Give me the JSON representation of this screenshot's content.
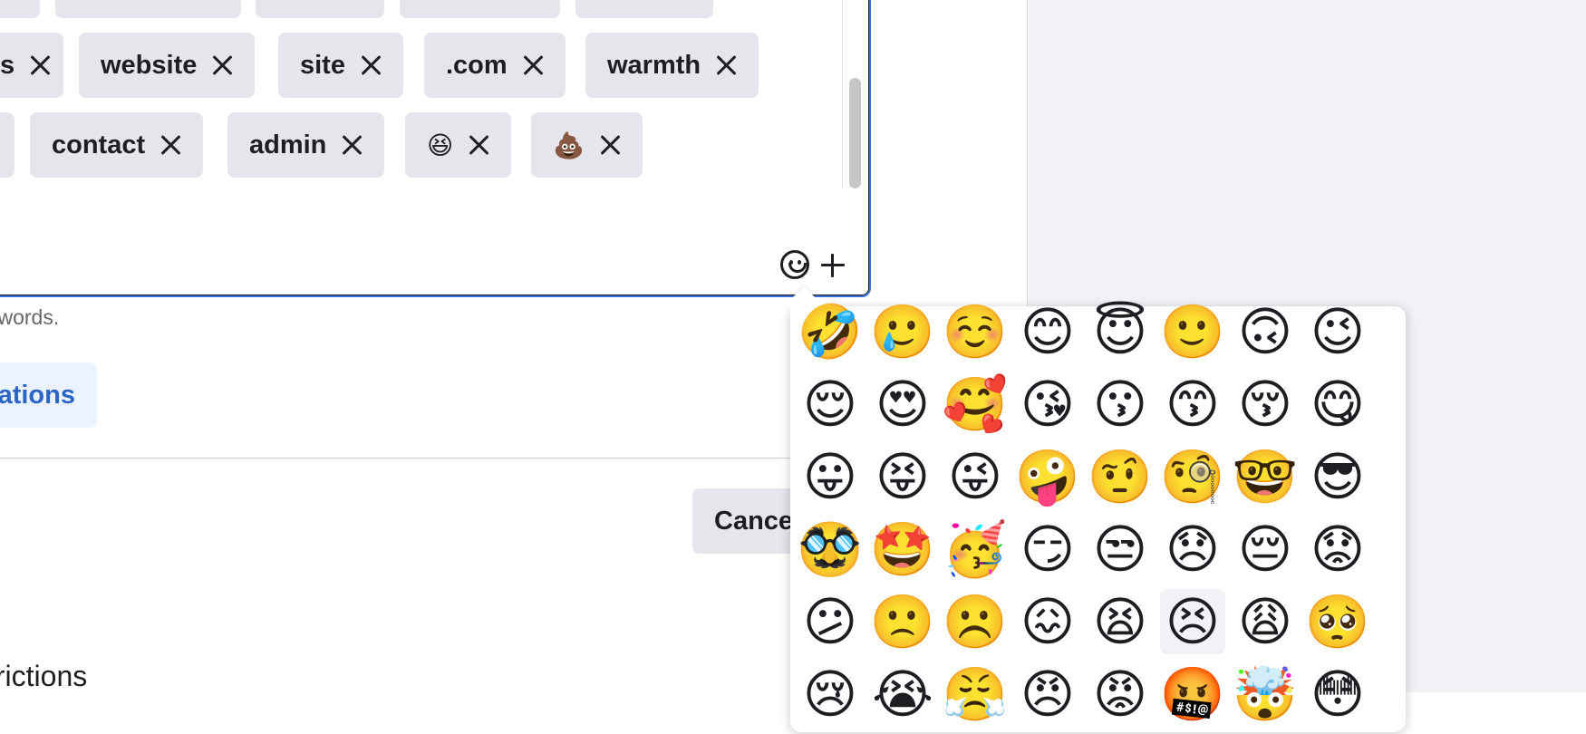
{
  "keyword_chips": [
    {
      "label": "",
      "row": 0
    },
    {
      "label": "",
      "row": 0
    },
    {
      "label": "",
      "row": 0
    },
    {
      "label": "",
      "row": 0
    },
    {
      "label": "",
      "row": 0
    },
    {
      "label": "s",
      "row": 1
    },
    {
      "label": "website",
      "row": 1
    },
    {
      "label": "site",
      "row": 1
    },
    {
      "label": ".com",
      "row": 1
    },
    {
      "label": "warmth",
      "row": 1
    },
    {
      "label": "",
      "row": 2
    },
    {
      "label": "contact",
      "row": 2
    },
    {
      "label": "admin",
      "row": 2
    },
    {
      "label": "😆",
      "row": 2
    },
    {
      "label": "💩",
      "row": 2
    }
  ],
  "keyword_box": {
    "emoji_button_icon": "smiley-icon",
    "add_button_icon": "plus-icon",
    "remove_icon": "close-icon"
  },
  "helper_text": "ywords.",
  "blue_button_label": "ations",
  "cancel_label": "Cancel",
  "section_heading": "trictions",
  "colors": {
    "focus_border": "#3b6fd6",
    "chip_bg": "#e4e6eb",
    "link_blue": "#2d65c6",
    "panel_gray": "#f0f2f5"
  },
  "emoji_picker": {
    "rows": [
      [
        "🤣",
        "🥲",
        "☺️",
        "😊",
        "😇",
        "🙂",
        "🙃",
        "😉"
      ],
      [
        "😌",
        "😍",
        "🥰",
        "😘",
        "😗",
        "😙",
        "😚",
        "😋"
      ],
      [
        "😛",
        "😝",
        "😜",
        "🤪",
        "🤨",
        "🧐",
        "🤓",
        "😎"
      ],
      [
        "🥸",
        "🤩",
        "🥳",
        "😏",
        "😒",
        "😞",
        "😔",
        "😟"
      ],
      [
        "😕",
        "🙁",
        "☹️",
        "😖",
        "😫",
        "😣",
        "😩",
        "🥺"
      ],
      [
        "😢",
        "😭",
        "😤",
        "😠",
        "😡",
        "🤬",
        "🤯",
        "😳"
      ]
    ],
    "selected": "😣"
  }
}
